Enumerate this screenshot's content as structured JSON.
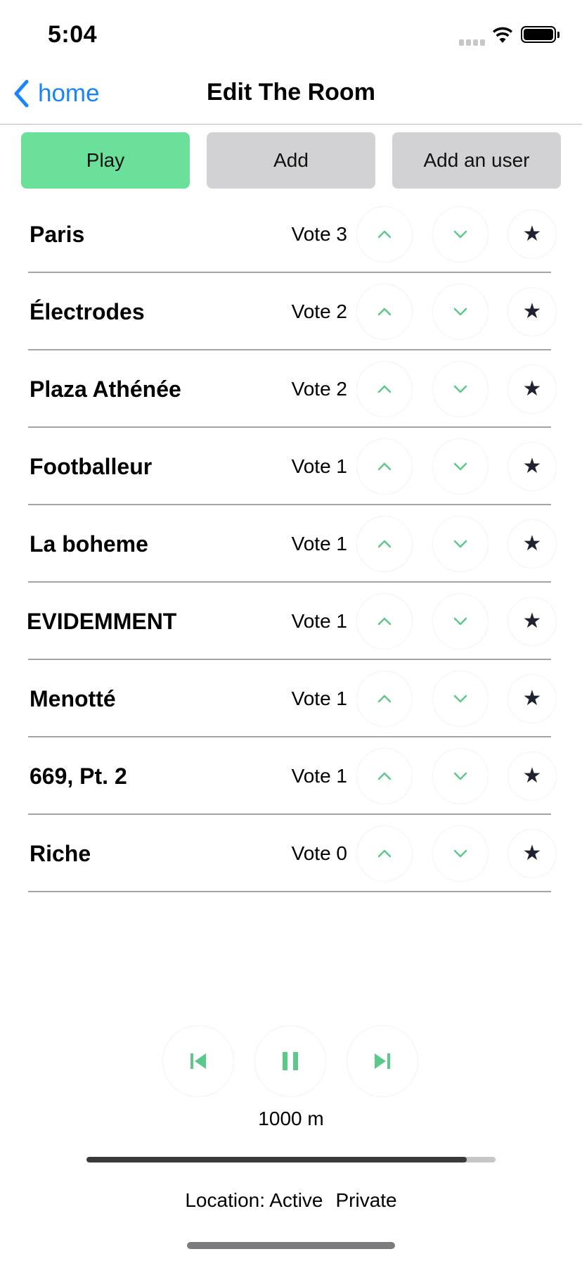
{
  "status_bar": {
    "time": "5:04"
  },
  "nav": {
    "back_label": "home",
    "title": "Edit The Room"
  },
  "actions": {
    "play_label": "Play",
    "add_label": "Add",
    "add_user_label": "Add an user"
  },
  "colors": {
    "accent_green": "#5cc98a",
    "play_button": "#6ae09b",
    "link_blue": "#1a84ff",
    "button_gray": "#d2d2d4"
  },
  "songs": [
    {
      "title": "Paris",
      "vote": "Vote 3"
    },
    {
      "title": "Électrodes",
      "vote": "Vote 2"
    },
    {
      "title": "Plaza Athénée",
      "vote": "Vote 2"
    },
    {
      "title": "Footballeur",
      "vote": "Vote 1"
    },
    {
      "title": "La boheme",
      "vote": "Vote 1"
    },
    {
      "title": "EVIDEMMENT",
      "vote": "Vote 1"
    },
    {
      "title": "Menotté",
      "vote": "Vote 1"
    },
    {
      "title": "669, Pt. 2",
      "vote": "Vote 1"
    },
    {
      "title": "Riche",
      "vote": "Vote 0"
    }
  ],
  "player": {
    "distance": "1000 m",
    "progress_percent": 93,
    "location_status": "Location: Active",
    "privacy": "Private"
  }
}
